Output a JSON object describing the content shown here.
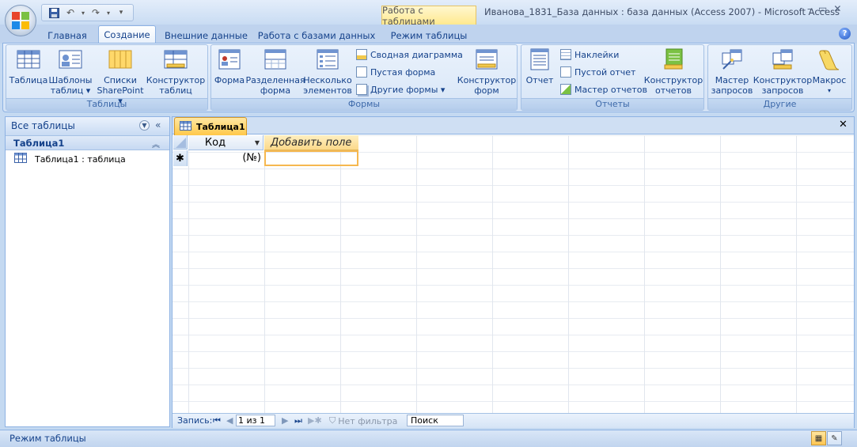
{
  "window": {
    "title": "Иванова_1831_База данных : база данных (Access 2007)  -  Microsoft Access",
    "context_tab_group": "Работа с таблицами",
    "controls": [
      "–",
      "▭",
      "✕"
    ]
  },
  "qat": {
    "more": "▾"
  },
  "tabs": [
    "Главная",
    "Создание",
    "Внешние данные",
    "Работа с базами данных",
    "Режим таблицы"
  ],
  "active_tab": "Создание",
  "ribbon": {
    "groups": {
      "tables": {
        "label": "Таблицы",
        "buttons": [
          {
            "line1": "Таблица",
            "line2": ""
          },
          {
            "line1": "Шаблоны",
            "line2": "таблиц ▾"
          },
          {
            "line1": "Списки",
            "line2": "SharePoint ▾"
          },
          {
            "line1": "Конструктор",
            "line2": "таблиц"
          }
        ]
      },
      "forms": {
        "label": "Формы",
        "buttons": [
          {
            "line1": "Форма",
            "line2": ""
          },
          {
            "line1": "Разделенная",
            "line2": "форма"
          },
          {
            "line1": "Несколько",
            "line2": "элементов"
          }
        ],
        "small": [
          "Сводная диаграмма",
          "Пустая форма",
          "Другие формы ▾"
        ],
        "designer": {
          "line1": "Конструктор",
          "line2": "форм"
        }
      },
      "reports": {
        "label": "Отчеты",
        "report": "Отчет",
        "small": [
          "Наклейки",
          "Пустой отчет",
          "Мастер отчетов"
        ],
        "designer": {
          "line1": "Конструктор",
          "line2": "отчетов"
        }
      },
      "other": {
        "label": "Другие",
        "buttons": [
          {
            "line1": "Мастер",
            "line2": "запросов"
          },
          {
            "line1": "Конструктор",
            "line2": "запросов"
          },
          {
            "line1": "Макрос",
            "line2": "▾"
          }
        ]
      }
    }
  },
  "nav": {
    "title": "Все таблицы",
    "group": "Таблица1",
    "items": [
      "Таблица1 : таблица"
    ]
  },
  "document": {
    "tab": "Таблица1",
    "close": "✕",
    "columns": [
      "Код",
      "Добавить поле"
    ],
    "new_row_marker": "✱",
    "new_row_value": "(№)"
  },
  "record_nav": {
    "label": "Запись:",
    "current": "1 из 1",
    "filter": "Нет фильтра",
    "search": "Поиск"
  },
  "status": {
    "text": "Режим таблицы"
  },
  "colors": {
    "accent": "#15428b",
    "highlight": "#ffc84a",
    "ribbon": "#dbe8f8"
  }
}
